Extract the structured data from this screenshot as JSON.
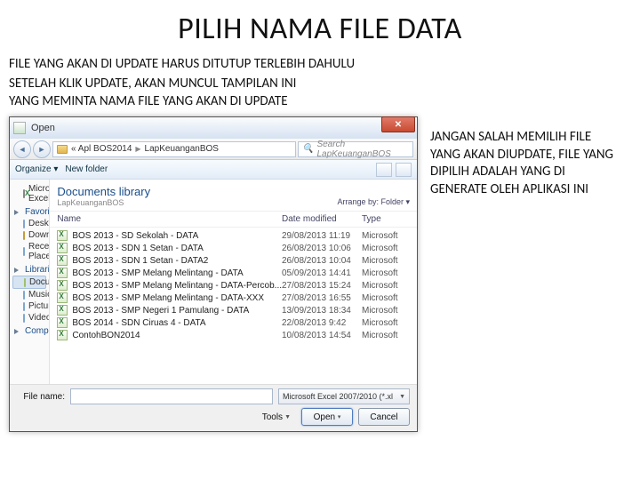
{
  "title": "PILIH NAMA FILE DATA",
  "subtitle1": "FILE YANG AKAN DI UPDATE HARUS DITUTUP TERLEBIH DAHULU",
  "subtitle2": "SETELAH KLIK UPDATE, AKAN MUNCUL TAMPILAN INI",
  "subtitle3": "YANG MEMINTA NAMA FILE YANG AKAN DI UPDATE",
  "sidenote": "JANGAN SALAH MEMILIH FILE YANG AKAN DIUPDATE, FILE YANG DIPILIH ADALAH YANG DI GENERATE OLEH APLIKASI INI",
  "dialog": {
    "title": "Open",
    "breadcrumb": {
      "b1": "« Apl BOS2014",
      "b2": "LapKeuanganBOS"
    },
    "search_placeholder": "Search LapKeuanganBOS",
    "toolbar": {
      "organize": "Organize ▾",
      "newfolder": "New folder"
    },
    "navpane": {
      "app": "Microsoft Excel",
      "fav": "Favorites",
      "fav_items": {
        "desktop": "Desktop",
        "downloads": "Downloads",
        "recent": "Recent Places"
      },
      "lib": "Libraries",
      "lib_items": {
        "documents": "Documents",
        "music": "Music",
        "pictures": "Pictures",
        "videos": "Videos"
      },
      "computer": "Computer"
    },
    "library": {
      "title": "Documents library",
      "subtitle": "LapKeuanganBOS",
      "arrange": "Arrange by:  Folder ▾"
    },
    "columns": {
      "name": "Name",
      "date": "Date modified",
      "type": "Type"
    },
    "files": [
      {
        "name": "BOS 2013 - SD Sekolah - DATA",
        "date": "29/08/2013 11:19",
        "type": "Microsoft"
      },
      {
        "name": "BOS 2013 - SDN 1 Setan - DATA",
        "date": "26/08/2013 10:06",
        "type": "Microsoft"
      },
      {
        "name": "BOS 2013 - SDN 1 Setan - DATA2",
        "date": "26/08/2013 10:04",
        "type": "Microsoft"
      },
      {
        "name": "BOS 2013 - SMP Melang Melintang - DATA",
        "date": "05/09/2013 14:41",
        "type": "Microsoft"
      },
      {
        "name": "BOS 2013 - SMP Melang Melintang - DATA-Percob...",
        "date": "27/08/2013 15:24",
        "type": "Microsoft"
      },
      {
        "name": "BOS 2013 - SMP Melang Melintang - DATA-XXX",
        "date": "27/08/2013 16:55",
        "type": "Microsoft"
      },
      {
        "name": "BOS 2013 - SMP Negeri 1 Pamulang - DATA",
        "date": "13/09/2013 18:34",
        "type": "Microsoft"
      },
      {
        "name": "BOS 2014 - SDN Ciruas 4 - DATA",
        "date": "22/08/2013 9:42",
        "type": "Microsoft"
      },
      {
        "name": "ContohBON2014",
        "date": "10/08/2013 14:54",
        "type": "Microsoft"
      }
    ],
    "filename_label": "File name:",
    "filter": "Microsoft Excel 2007/2010 (*.xl",
    "tools": "Tools",
    "open": "Open",
    "cancel": "Cancel"
  }
}
